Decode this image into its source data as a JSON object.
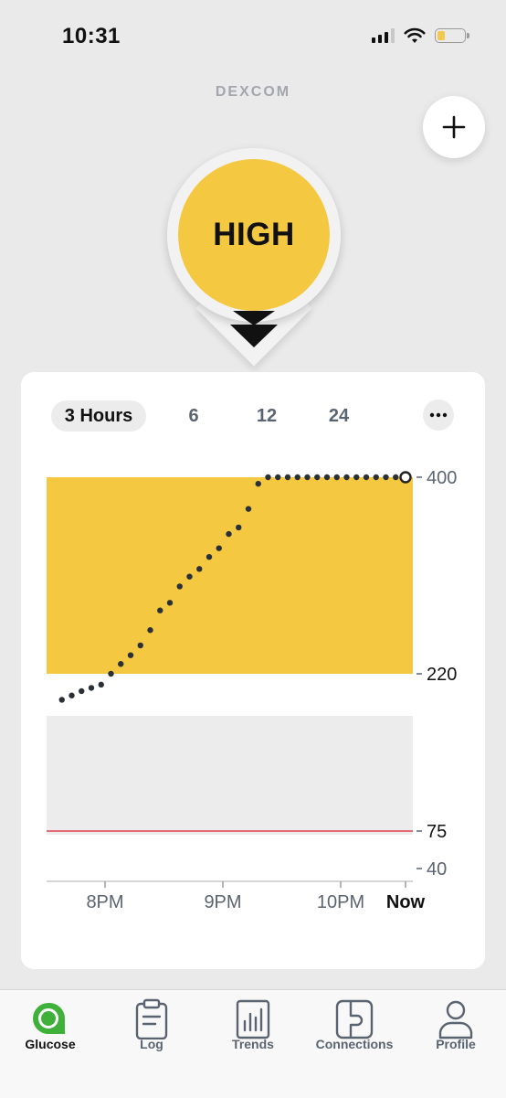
{
  "status_bar": {
    "time": "10:31",
    "signal_icon": "signal-bars-icon",
    "wifi_icon": "wifi-icon",
    "battery_icon": "battery-icon",
    "battery_level": 0.3,
    "battery_color": "#f2c94c"
  },
  "brand": "Dexcom",
  "header": {
    "add_icon": "plus-icon"
  },
  "glucose": {
    "value_label": "HIGH",
    "trend_icon": "double-arrow-down-icon",
    "color": "#f5c842"
  },
  "chart_tabs": {
    "items": [
      "3 Hours",
      "6",
      "12",
      "24"
    ],
    "active_index": 0,
    "more_icon": "more-horizontal-icon"
  },
  "chart_data": {
    "type": "scatter",
    "title": "",
    "xlabel": "",
    "ylabel": "",
    "x_ticks": [
      "8PM",
      "9PM",
      "10PM",
      "Now"
    ],
    "y_ticks": [
      "400",
      "220",
      "75",
      "40"
    ],
    "high_threshold": 220,
    "low_threshold": 75,
    "ylim": [
      40,
      400
    ],
    "xlim_minutes": [
      -180,
      0
    ],
    "high_band_color": "#f5c842",
    "target_band_color": "#ececec",
    "low_line_color": "#e0424f",
    "series": [
      {
        "x": [
          -175,
          -170,
          -165,
          -160,
          -155,
          -150,
          -145,
          -140,
          -135,
          -130,
          -125,
          -120,
          -115,
          -110,
          -105,
          -100,
          -95,
          -90,
          -85,
          -80,
          -75,
          -70,
          -65,
          -60,
          -55,
          -50,
          -45,
          -40,
          -35,
          -30,
          -25,
          -20,
          -15,
          -10,
          -5,
          0
        ],
        "y": [
          196,
          200,
          204,
          207,
          210,
          220,
          229,
          237,
          246,
          260,
          278,
          285,
          300,
          309,
          316,
          327,
          335,
          348,
          354,
          371,
          394,
          400,
          400,
          400,
          400,
          400,
          400,
          400,
          400,
          400,
          400,
          400,
          400,
          400,
          400,
          400
        ]
      }
    ],
    "latest_point_style": "hollow"
  },
  "tab_bar": {
    "items": [
      {
        "label": "Glucose",
        "icon": "glucose-drop-icon"
      },
      {
        "label": "Log",
        "icon": "clipboard-icon"
      },
      {
        "label": "Trends",
        "icon": "trends-chart-icon"
      },
      {
        "label": "Connections",
        "icon": "connections-icon"
      },
      {
        "label": "Profile",
        "icon": "profile-person-icon"
      }
    ],
    "active_index": 0,
    "active_color": "#3fb039"
  }
}
